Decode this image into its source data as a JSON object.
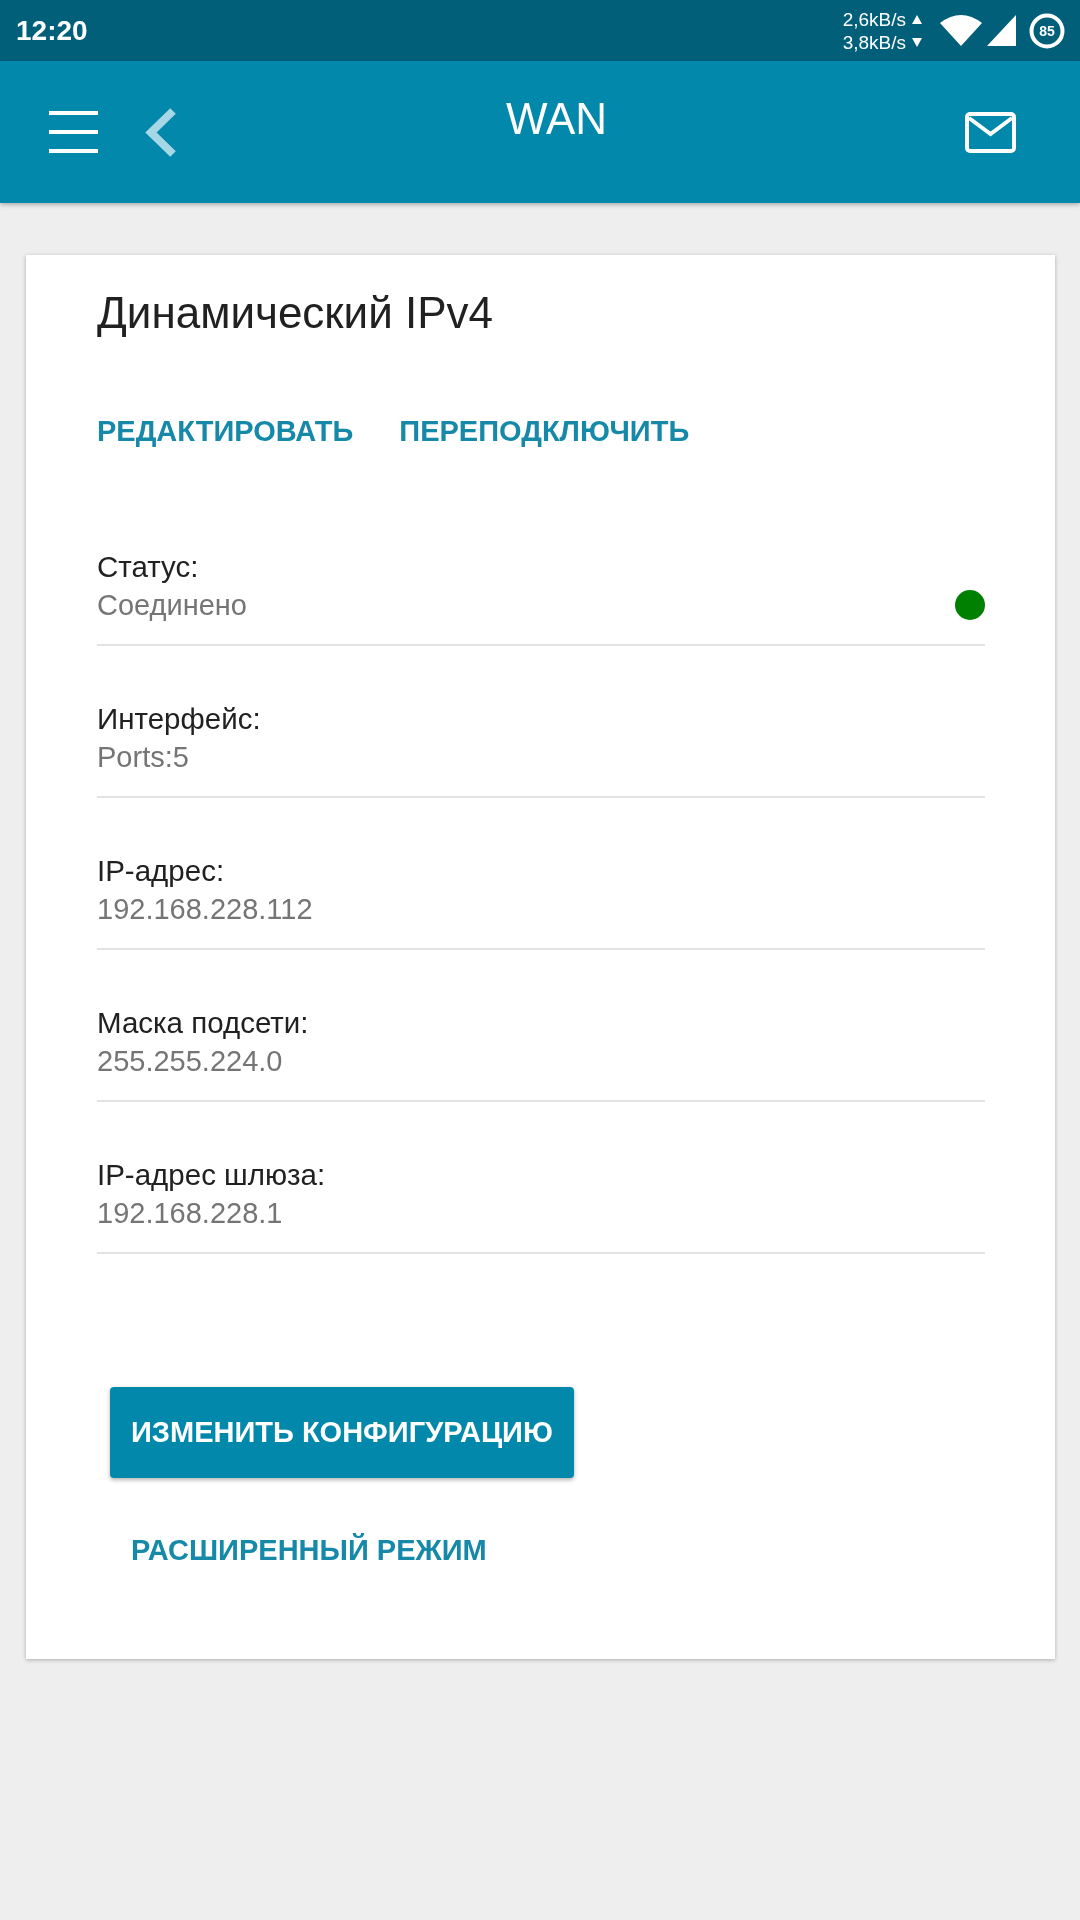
{
  "status_bar": {
    "time": "12:20",
    "upload_speed": "2,6kB/s",
    "download_speed": "3,8kB/s",
    "battery": "85"
  },
  "app_bar": {
    "title": "WAN"
  },
  "card": {
    "title": "Динамический IPv4",
    "actions": [
      "РЕДАКТИРОВАТЬ",
      "ПЕРЕПОДКЛЮЧИТЬ"
    ],
    "fields": [
      {
        "label": "Статус:",
        "value": "Соединено",
        "color": "#008000"
      },
      {
        "label": "Интерфейс:",
        "value": "Ports:5"
      },
      {
        "label": "IP-адрес:",
        "value": "192.168.228.112"
      },
      {
        "label": "Маска подсети:",
        "value": "255.255.224.0"
      },
      {
        "label": "IP-адрес шлюза:",
        "value": "192.168.228.1"
      }
    ],
    "primary_button": "ИЗМЕНИТЬ КОНФИГУРАЦИЮ",
    "secondary_button": "РАСШИРЕННЫЙ РЕЖИМ"
  }
}
